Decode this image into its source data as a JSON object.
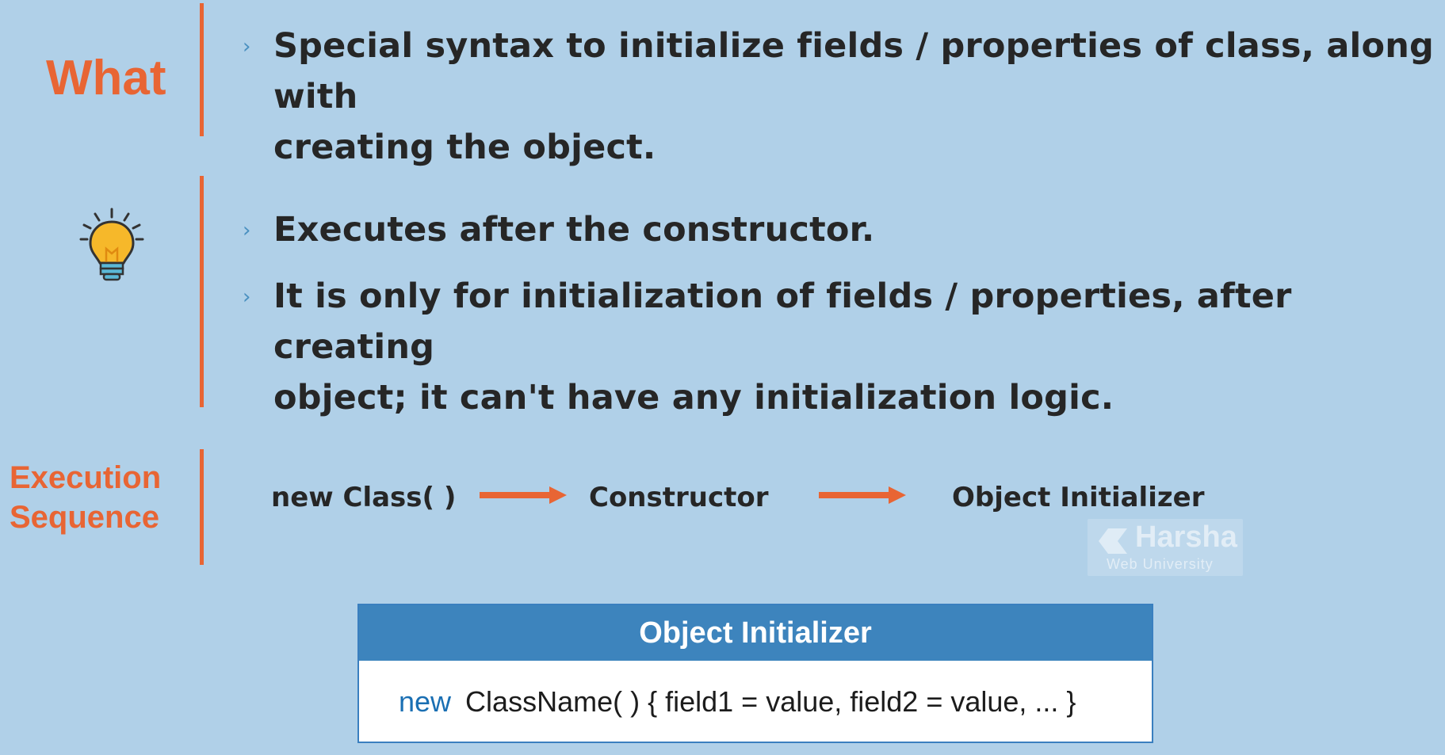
{
  "what": {
    "label": "What",
    "bullets": [
      {
        "line1": "Special syntax to initialize fields / properties of class, along with",
        "line2": "creating the object."
      }
    ]
  },
  "tips": {
    "icon": "lightbulb-icon",
    "bullets": [
      {
        "line1": "Executes after the constructor."
      },
      {
        "line1": "It is only for initialization of fields / properties, after creating",
        "line2": "object; it can't have any initialization logic."
      }
    ]
  },
  "execution": {
    "label_line1": "Execution",
    "label_line2": "Sequence",
    "steps": [
      "new Class( )",
      "Constructor",
      "Object Initializer"
    ]
  },
  "code_box": {
    "title": "Object Initializer",
    "keyword": "new",
    "code": "ClassName( )  { field1 = value, field2 = value, ... }"
  },
  "watermark": {
    "title": "Harsha",
    "subtitle": "Web University"
  },
  "colors": {
    "background": "#b0d0e8",
    "accent": "#e86534",
    "box_header": "#3d84bd",
    "keyword": "#1a6fb3"
  }
}
